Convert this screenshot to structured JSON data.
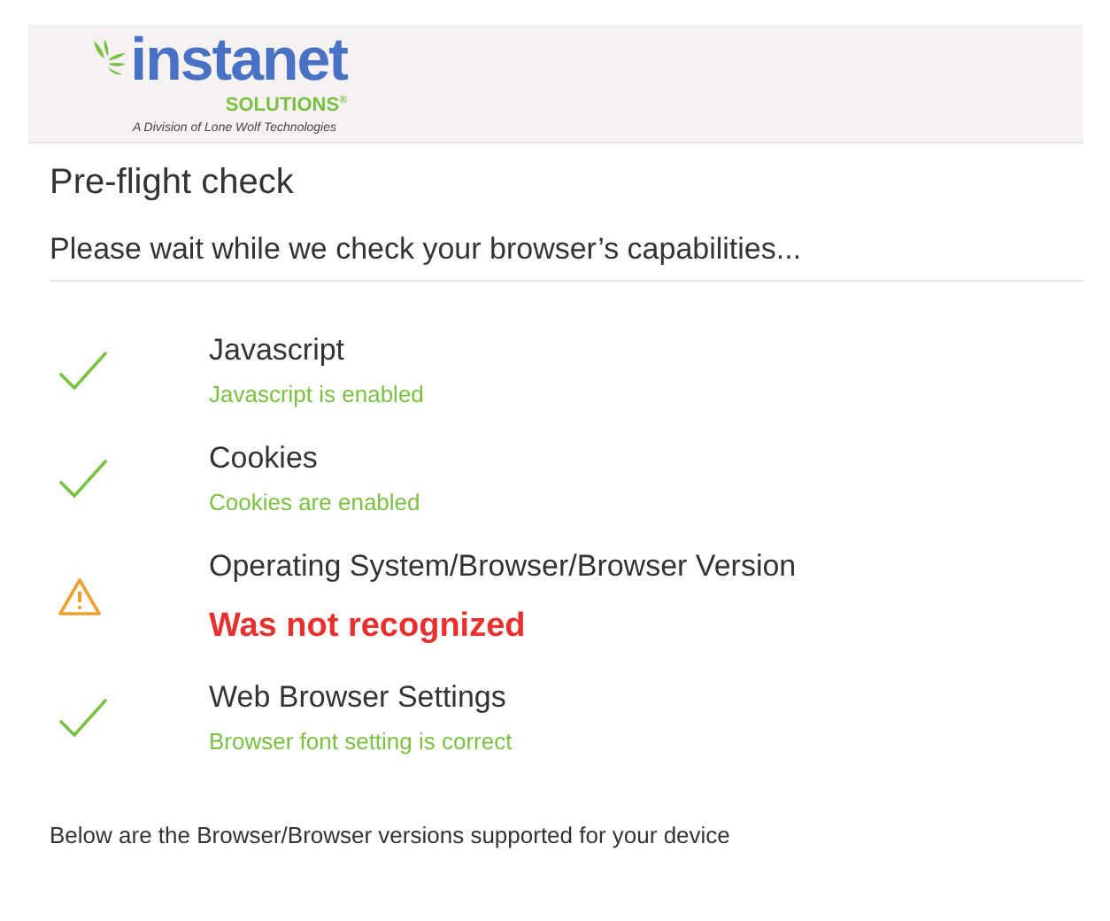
{
  "logo": {
    "name": "instanet",
    "suffix": "SOLUTIONS$^{®}$",
    "tagline": "A Division of Lone Wolf Technologies"
  },
  "title": "Pre-flight check",
  "subtitle": "Please wait while we check your browser’s capabilities...",
  "checks": [
    {
      "kind": "ok",
      "name": "Javascript",
      "status": "Javascript is enabled"
    },
    {
      "kind": "ok",
      "name": "Cookies",
      "status": "Cookies are enabled"
    },
    {
      "kind": "warning",
      "name": "Operating System/Browser/Browser Version",
      "status": "Was not recognized"
    },
    {
      "kind": "ok",
      "name": "Web Browser Settings",
      "status": "Browser font setting is correct"
    }
  ],
  "footer": "Below are the Browser/Browser versions supported for your device"
}
